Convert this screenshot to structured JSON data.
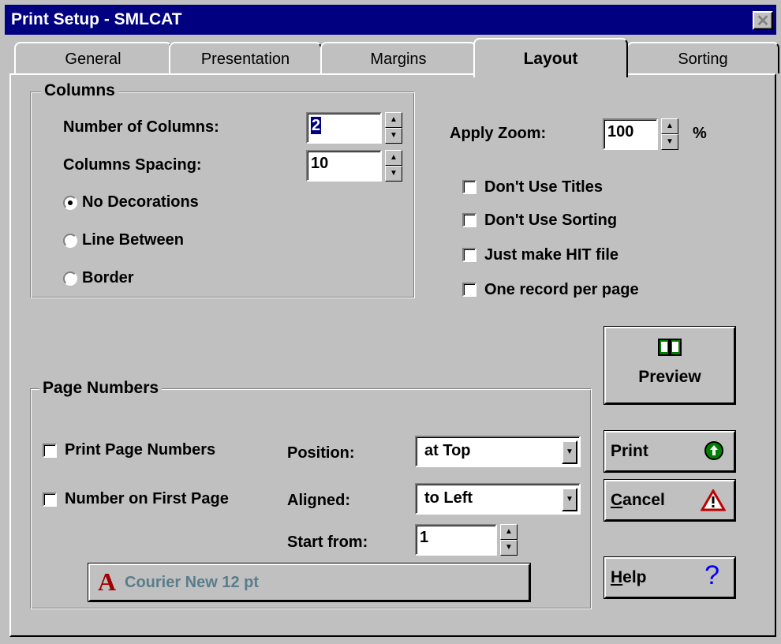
{
  "window": {
    "title": "Print Setup - SMLCAT",
    "close_glyph": "✕"
  },
  "tabs": [
    {
      "label": "General"
    },
    {
      "label": "Presentation"
    },
    {
      "label": "Margins"
    },
    {
      "label": "Layout",
      "active": true
    },
    {
      "label": "Sorting"
    }
  ],
  "columns": {
    "group_label": "Columns",
    "number_label": "Number of Columns:",
    "number_value": "2",
    "spacing_label": "Columns Spacing:",
    "spacing_value": "10",
    "radios": [
      {
        "label": "No Decorations",
        "checked": true
      },
      {
        "label": "Line Between",
        "checked": false
      },
      {
        "label": "Border",
        "checked": false
      }
    ]
  },
  "zoom": {
    "label": "Apply Zoom:",
    "value": "100",
    "unit": "%"
  },
  "options": [
    {
      "label": "Don't Use Titles",
      "checked": false
    },
    {
      "label": "Don't Use Sorting",
      "checked": false
    },
    {
      "label": "Just make HIT file",
      "checked": false
    },
    {
      "label": "One record per page",
      "checked": false
    }
  ],
  "preview": {
    "label": "Preview",
    "icon": "book-icon",
    "icon_color": "#008000"
  },
  "page_numbers": {
    "group_label": "Page Numbers",
    "print_label": "Print Page Numbers",
    "first_label": "Number on First Page",
    "position_label": "Position:",
    "position_value": "at Top",
    "aligned_label": "Aligned:",
    "aligned_value": "to Left",
    "start_label": "Start from:",
    "start_value": "1",
    "font_label": "Courier New 12 pt",
    "font_icon_letter": "A",
    "font_icon_color": "#a00000"
  },
  "buttons": {
    "print": "Print",
    "cancel_prefix": "C",
    "cancel_rest": "ancel",
    "help_prefix": "H",
    "help_rest": "elp"
  },
  "colors": {
    "titlebar": "#000080",
    "face": "#c0c0c0",
    "font_button_text": "#5a7d8c"
  }
}
